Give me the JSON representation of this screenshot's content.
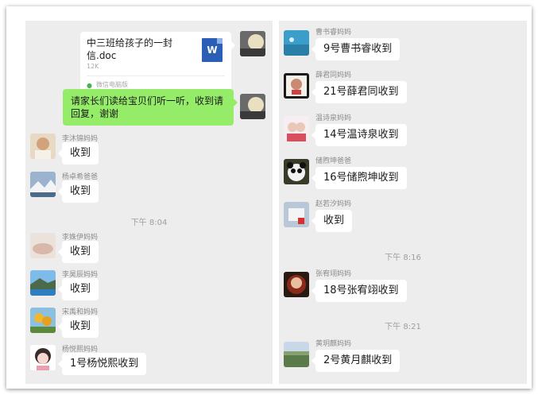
{
  "left_panel": {
    "file_message": {
      "title": "中三班给孩子的一封信.doc",
      "size": "12K",
      "source": "微信电脑版",
      "icon": "word-doc-icon"
    },
    "notice_message": "请家长们读给宝贝们听一听，收到请回复，谢谢",
    "messages": [
      {
        "name": "李沐锦妈妈",
        "text": "收到",
        "avatar_color": "#e8d9c4"
      },
      {
        "name": "杨卓希爸爸",
        "text": "收到",
        "avatar_color": "#7c9ab7"
      },
      {
        "name": "李姝伊妈妈",
        "text": "收到",
        "avatar_color": "#e0d0c8"
      },
      {
        "name": "李昊辰妈妈",
        "text": "收到",
        "avatar_color": "#5aa0d8"
      },
      {
        "name": "宋禹和妈妈",
        "text": "收到",
        "avatar_color": "#d8a83c"
      },
      {
        "name": "杨悦熙妈妈",
        "text": "1号杨悦熙收到",
        "avatar_color": "#f2c9cf"
      }
    ],
    "time_divider": "下午 8:04"
  },
  "right_panel": {
    "messages": [
      {
        "name": "曹书睿妈妈",
        "text": "9号曹书睿收到",
        "avatar_color": "#3b9dc9"
      },
      {
        "name": "薛君同妈妈",
        "text": "21号薛君同收到",
        "avatar_color": "#d8d0c4"
      },
      {
        "name": "温诗泉妈妈",
        "text": "14号温诗泉收到",
        "avatar_color": "#f0e0e4"
      },
      {
        "name": "储煦坤爸爸",
        "text": "16号储煦坤收到",
        "avatar_color": "#2a2a22"
      },
      {
        "name": "赵若汐妈妈",
        "text": "收到",
        "avatar_color": "#b8c8d8"
      },
      {
        "name": "张宥翊妈妈",
        "text": "18号张宥翊收到",
        "avatar_color": "#8a3a2a"
      },
      {
        "name": "黄玥麒妈妈",
        "text": "2号黄月麒收到",
        "avatar_color": "#6a8a5a"
      }
    ],
    "time_dividers": [
      "下午 8:16",
      "下午 8:21"
    ]
  },
  "self_avatar_color": "#c8b898"
}
